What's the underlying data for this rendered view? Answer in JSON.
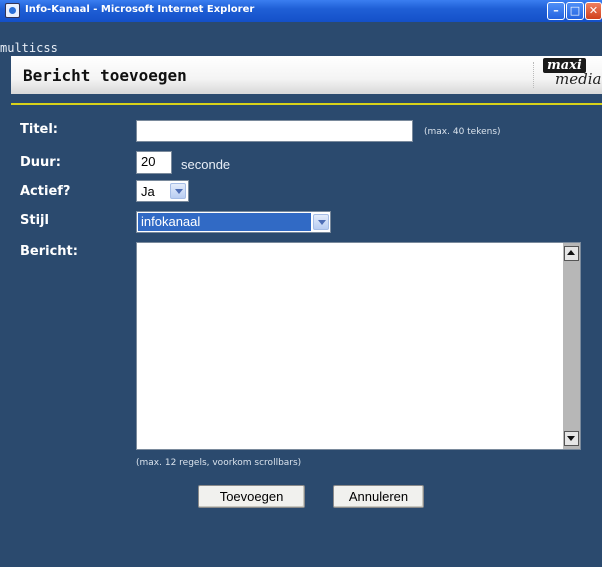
{
  "window": {
    "title": "Info-Kanaal - Microsoft Internet Explorer",
    "min_glyph": "–",
    "max_glyph": "□",
    "close_glyph": "✕"
  },
  "site": {
    "name": "multicss"
  },
  "header": {
    "title": "Bericht toevoegen",
    "logo_top": "maxi",
    "logo_bottom": "media"
  },
  "form": {
    "titel": {
      "label": "Titel:",
      "value": "",
      "hint": "(max. 40 tekens)"
    },
    "duur": {
      "label": "Duur:",
      "value": "20",
      "unit": "seconde"
    },
    "actief": {
      "label": "Actief?",
      "selected": "Ja"
    },
    "stijl": {
      "label": "Stijl",
      "selected": "infokanaal"
    },
    "bericht": {
      "label": "Bericht:",
      "value": "",
      "hint": "(max. 12 regels, voorkom scrollbars)"
    }
  },
  "buttons": {
    "add": "Toevoegen",
    "cancel": "Annuleren"
  },
  "colors": {
    "background": "#2b4a6e",
    "accent_line": "#d8d21a",
    "selection": "#316ac5"
  }
}
